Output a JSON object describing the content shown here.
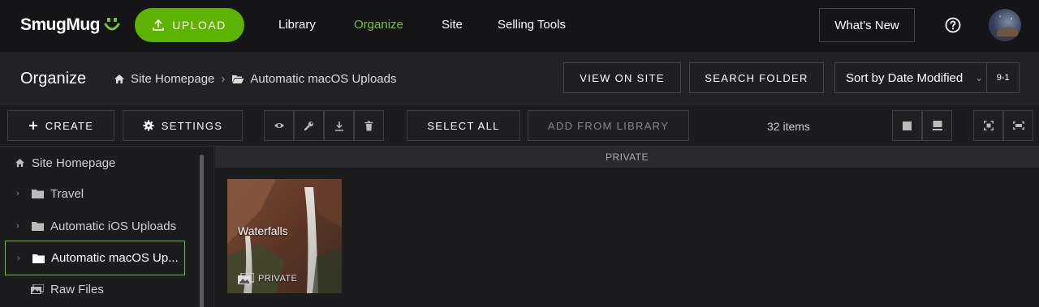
{
  "nav": {
    "logo": "SmugMug",
    "upload_label": "UPLOAD",
    "links": [
      "Library",
      "Organize",
      "Site",
      "Selling Tools"
    ],
    "active_link": "Organize",
    "whats_new": "What's New"
  },
  "header": {
    "title": "Organize",
    "breadcrumb": [
      "Site Homepage",
      "Automatic macOS Uploads"
    ],
    "view_on_site": "VIEW ON SITE",
    "search_folder": "SEARCH FOLDER",
    "sort_label": "Sort by Date Modified",
    "sort_direction": "9-1"
  },
  "toolbar": {
    "create": "CREATE",
    "settings": "SETTINGS",
    "select_all": "SELECT ALL",
    "add_from_library": "ADD FROM LIBRARY",
    "item_count": "32 items"
  },
  "sidebar": {
    "items": [
      {
        "label": "Site Homepage"
      },
      {
        "label": "Travel"
      },
      {
        "label": "Automatic iOS Uploads"
      },
      {
        "label": "Automatic macOS Up..."
      },
      {
        "label": "Raw Files"
      }
    ]
  },
  "main": {
    "section_label": "PRIVATE",
    "tiles": [
      {
        "title": "Waterfalls",
        "badge": "PRIVATE"
      }
    ]
  },
  "colors": {
    "accent": "#5cb400",
    "active_link": "#7ac142",
    "selection_border": "#6dbb2e"
  }
}
